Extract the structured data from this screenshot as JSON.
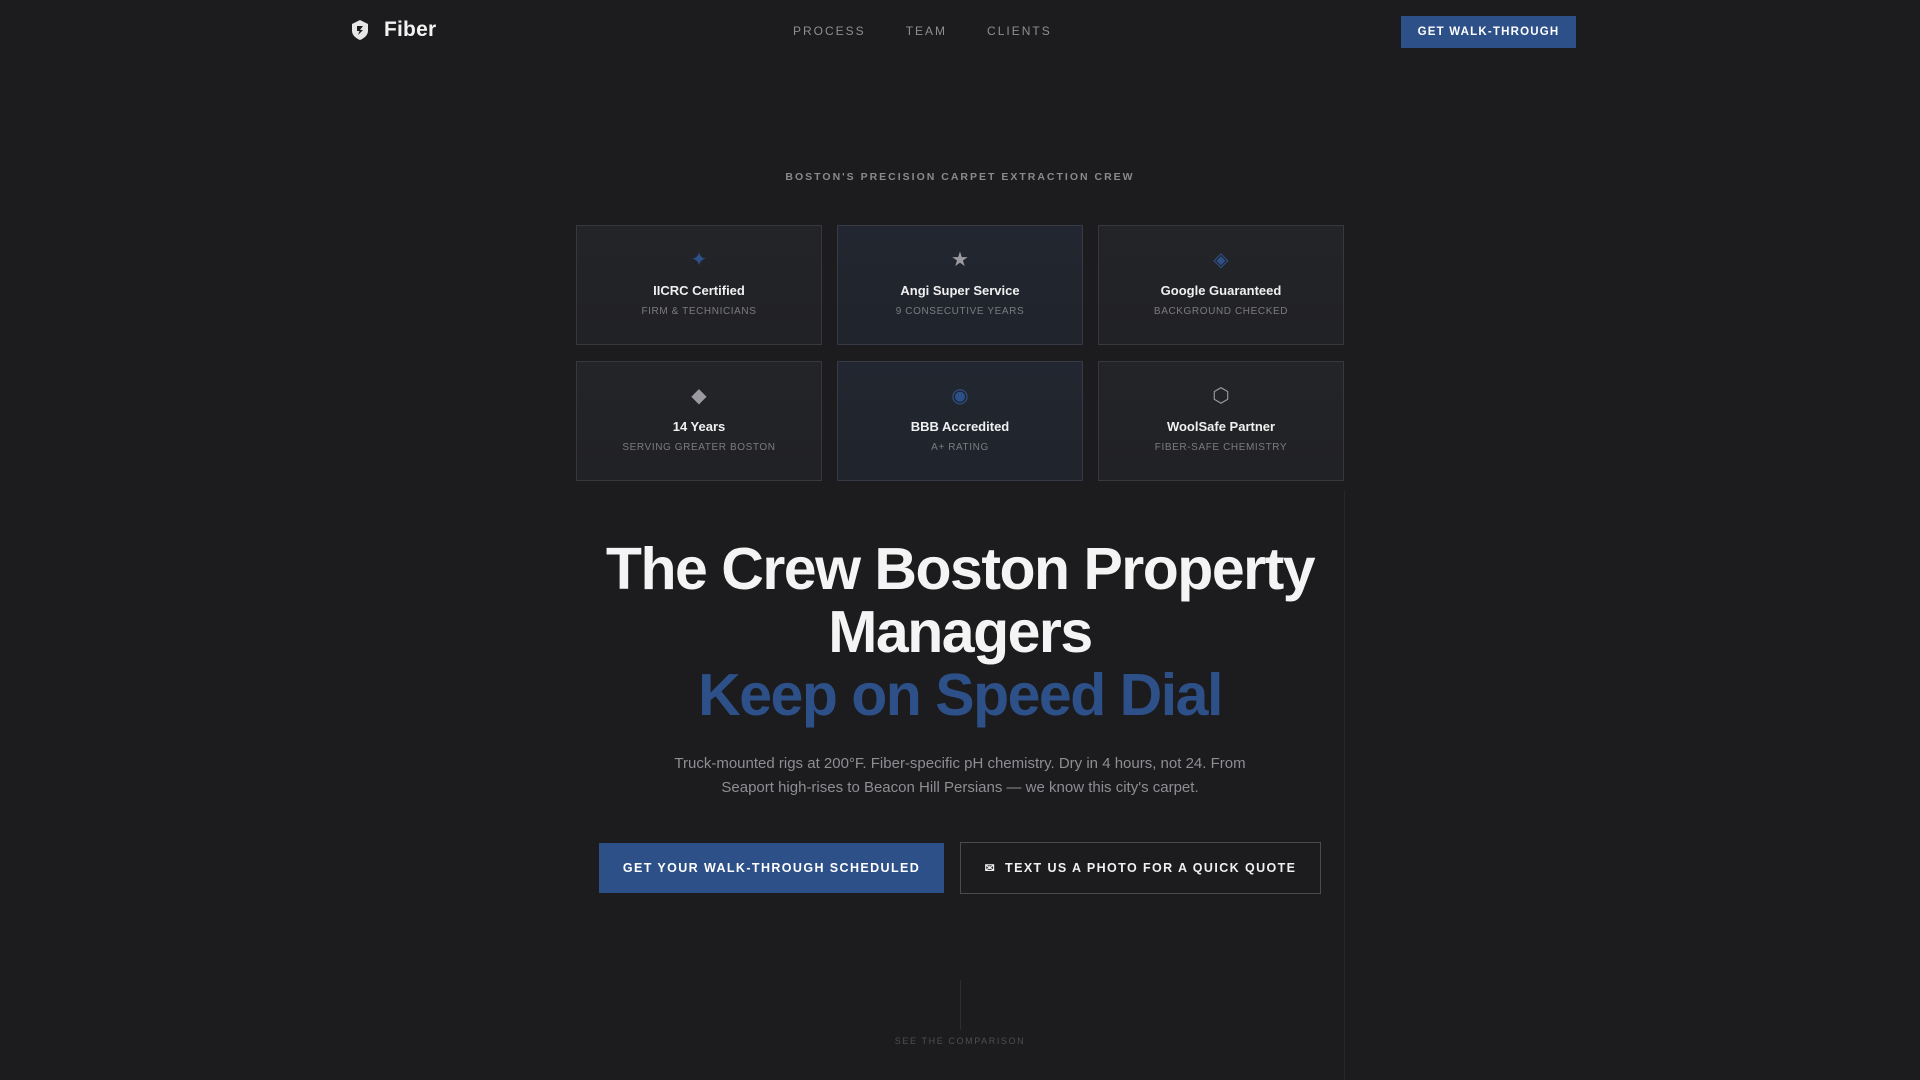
{
  "nav": {
    "brand": "Fiber",
    "links": [
      "PROCESS",
      "TEAM",
      "CLIENTS"
    ],
    "cta": "GET WALK-THROUGH"
  },
  "hero": {
    "eyebrow": "BOSTON'S PRECISION CARPET EXTRACTION CREW",
    "title_line1": "The Crew Boston Property",
    "title_line2": "Managers",
    "title_accent": "Keep on Speed Dial",
    "subtitle": "Truck-mounted rigs at 200°F. Fiber-specific pH chemistry. Dry in 4 hours, not 24. From Seaport high-rises to Beacon Hill Persians — we know this city's carpet.",
    "primary_cta": "GET YOUR WALK-THROUGH SCHEDULED",
    "secondary_cta": "TEXT US A PHOTO FOR A QUICK QUOTE",
    "scroll_hint": "SEE THE COMPARISON"
  },
  "badges": [
    {
      "icon": "sparkle-icon",
      "glyph": "✦",
      "title": "IICRC Certified",
      "subtitle": "FIRM & TECHNICIANS"
    },
    {
      "icon": "star-icon",
      "glyph": "★",
      "title": "Angi Super Service",
      "subtitle": "9 CONSECUTIVE YEARS"
    },
    {
      "icon": "diamond-icon",
      "glyph": "◈",
      "title": "Google Guaranteed",
      "subtitle": "BACKGROUND CHECKED"
    },
    {
      "icon": "diamond-solid-icon",
      "glyph": "◆",
      "title": "14 Years",
      "subtitle": "SERVING GREATER BOSTON"
    },
    {
      "icon": "target-icon",
      "glyph": "◉",
      "title": "BBB Accredited",
      "subtitle": "A+ RATING"
    },
    {
      "icon": "hexagon-icon",
      "glyph": "⬡",
      "title": "WoolSafe Partner",
      "subtitle": "FIBER-SAFE CHEMISTRY"
    }
  ],
  "colors": {
    "background": "#1c1c1e",
    "accent": "#2d5089",
    "text": "#f4f4f4",
    "muted": "#8e8e93"
  }
}
